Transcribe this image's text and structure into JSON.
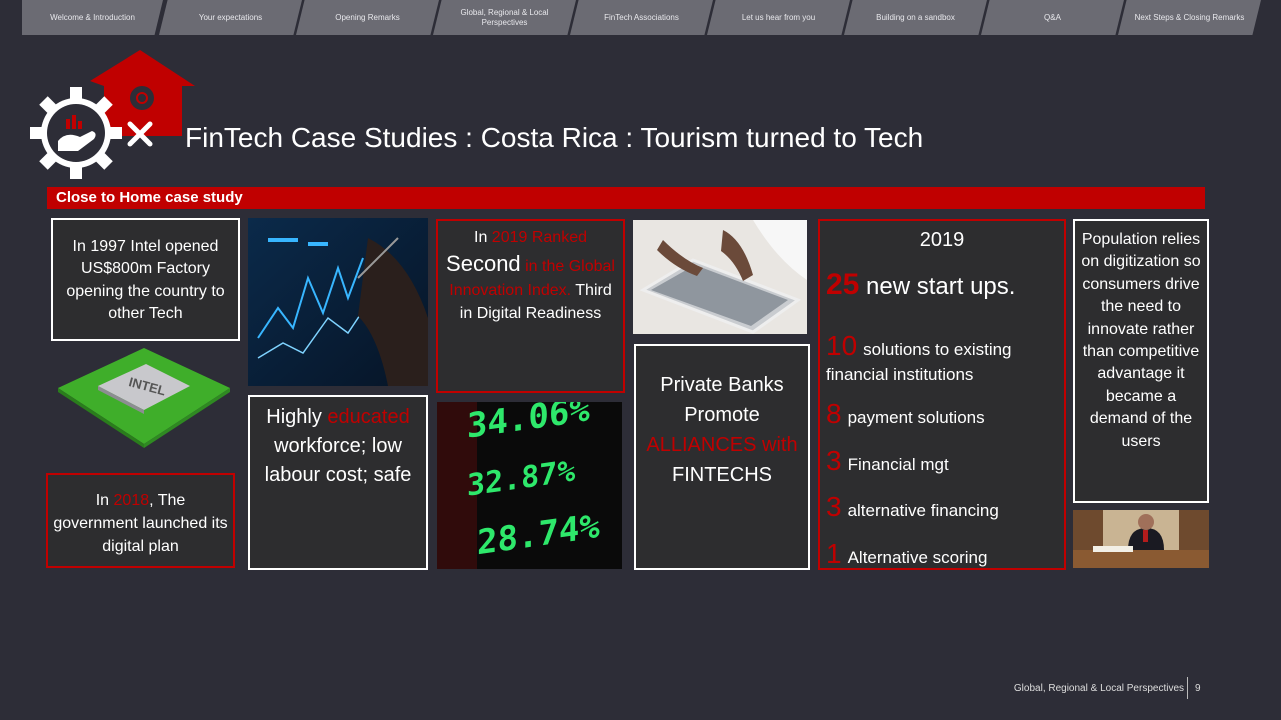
{
  "nav": {
    "tabs": [
      {
        "label": "Welcome & Introduction"
      },
      {
        "label": "Your expectations"
      },
      {
        "label": "Opening Remarks"
      },
      {
        "label": "Global, Regional & Local Perspectives"
      },
      {
        "label": "FinTech Associations"
      },
      {
        "label": "Let us hear from you"
      },
      {
        "label": "Building on a sandbox"
      },
      {
        "label": "Q&A"
      },
      {
        "label": "Next Steps & Closing Remarks"
      }
    ]
  },
  "slide": {
    "title": "FinTech Case Studies : Costa Rica : Tourism turned to Tech",
    "banner": "Close to Home case study",
    "intel_box": "In 1997 Intel opened US$800m Factory opening  the country to other Tech",
    "intel_chip_label": "INTEL",
    "gov_box": {
      "pre": "In ",
      "year": "2018",
      "post": ", The government launched its digital plan"
    },
    "workforce_box": {
      "pre": "Highly ",
      "highlight": "educated",
      "post": " workforce; low labour cost; safe"
    },
    "ranking_box": {
      "a": "In ",
      "b": "2019 Ranked",
      "c": "Second",
      "d": " in the Global Innovation Index.",
      "e": " Third in  Digital Readiness"
    },
    "banks_box": {
      "a": "Private Banks Promote ",
      "b": "ALLIANCES with",
      "c": " FINTECHS"
    },
    "startups": {
      "year": "2019",
      "count": "25",
      "count_label": " new start ups.",
      "items": [
        {
          "n": "10",
          "label": "solutions to existing financial institutions"
        },
        {
          "n": "8",
          "label": "payment solutions"
        },
        {
          "n": "3",
          "label": "Financial mgt"
        },
        {
          "n": "3",
          "label": "alternative financing"
        },
        {
          "n": "1",
          "label": "Alternative scoring"
        }
      ]
    },
    "population_box": "Population relies on digitization so consumers drive the need to innovate rather than competitive advantage it became a demand of the users",
    "ticker_text": [
      "34.06%",
      "32.87%",
      "28.74%"
    ]
  },
  "footer": {
    "text": "Global, Regional & Local Perspectives",
    "page": "9"
  },
  "colors": {
    "accent": "#c00000",
    "background": "#2d2d37",
    "tab": "#6b6b73"
  }
}
